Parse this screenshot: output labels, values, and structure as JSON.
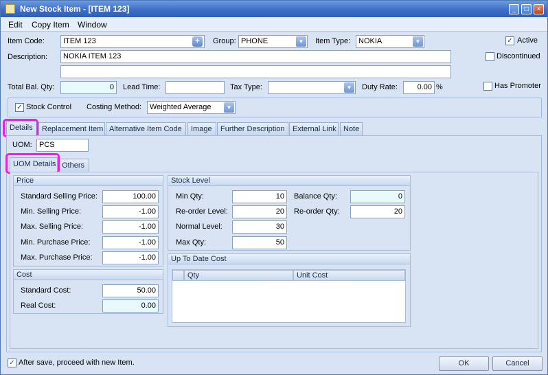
{
  "window": {
    "title": "New Stock Item - [ITEM 123]",
    "min": "_",
    "max": "□",
    "close": "×"
  },
  "menu": [
    "Edit",
    "Copy Item",
    "Window"
  ],
  "header": {
    "item_code_label": "Item Code:",
    "item_code": "ITEM 123",
    "group_label": "Group:",
    "group": "PHONE",
    "item_type_label": "Item Type:",
    "item_type": "NOKIA",
    "active_label": "Active",
    "active_checked": true,
    "description_label": "Description:",
    "description": "NOKIA ITEM 123",
    "description2": "",
    "discontinued_label": "Discontinued",
    "discontinued_checked": false,
    "total_bal_label": "Total Bal. Qty:",
    "total_bal": "0",
    "lead_time_label": "Lead Time:",
    "lead_time": "",
    "tax_type_label": "Tax Type:",
    "tax_type": "",
    "duty_rate_label": "Duty Rate:",
    "duty_rate": "0.00",
    "duty_unit": "%",
    "has_promoter_label": "Has Promoter",
    "has_promoter_checked": false,
    "stock_control_label": "Stock Control",
    "stock_control_checked": true,
    "costing_label": "Costing Method:",
    "costing": "Weighted Average"
  },
  "tabs": [
    "Details",
    "Replacement Item",
    "Alternative Item Code",
    "Image",
    "Further Description",
    "External Link",
    "Note"
  ],
  "uom": {
    "label": "UOM:",
    "value": "PCS"
  },
  "subtabs": [
    "UOM Details",
    "Others"
  ],
  "price": {
    "title": "Price",
    "rows": [
      {
        "label": "Standard Selling Price:",
        "value": "100.00"
      },
      {
        "label": "Min. Selling Price:",
        "value": "-1.00"
      },
      {
        "label": "Max. Selling Price:",
        "value": "-1.00"
      },
      {
        "label": "Min. Purchase Price:",
        "value": "-1.00"
      },
      {
        "label": "Max. Purchase Price:",
        "value": "-1.00"
      }
    ]
  },
  "cost": {
    "title": "Cost",
    "rows": [
      {
        "label": "Standard Cost:",
        "value": "50.00"
      },
      {
        "label": "Real Cost:",
        "value": "0.00"
      }
    ]
  },
  "stock_level": {
    "title": "Stock Level",
    "left": [
      {
        "label": "Min Qty:",
        "value": "10"
      },
      {
        "label": "Re-order Level:",
        "value": "20"
      },
      {
        "label": "Normal Level:",
        "value": "30"
      },
      {
        "label": "Max Qty:",
        "value": "50"
      }
    ],
    "right": [
      {
        "label": "Balance Qty:",
        "value": "0"
      },
      {
        "label": "Re-order Qty:",
        "value": "20"
      }
    ]
  },
  "up_to_date": {
    "title": "Up To Date Cost",
    "columns": [
      "Qty",
      "Unit Cost"
    ]
  },
  "footer": {
    "proceed_label": "After save, proceed with new Item.",
    "proceed_checked": true,
    "ok": "OK",
    "cancel": "Cancel"
  },
  "colors": {
    "title_bar": "#3d6fc8",
    "window_bg": "#d8e4f3",
    "highlight": "#ee1fe0",
    "cyan_field": "#e8fafc"
  }
}
